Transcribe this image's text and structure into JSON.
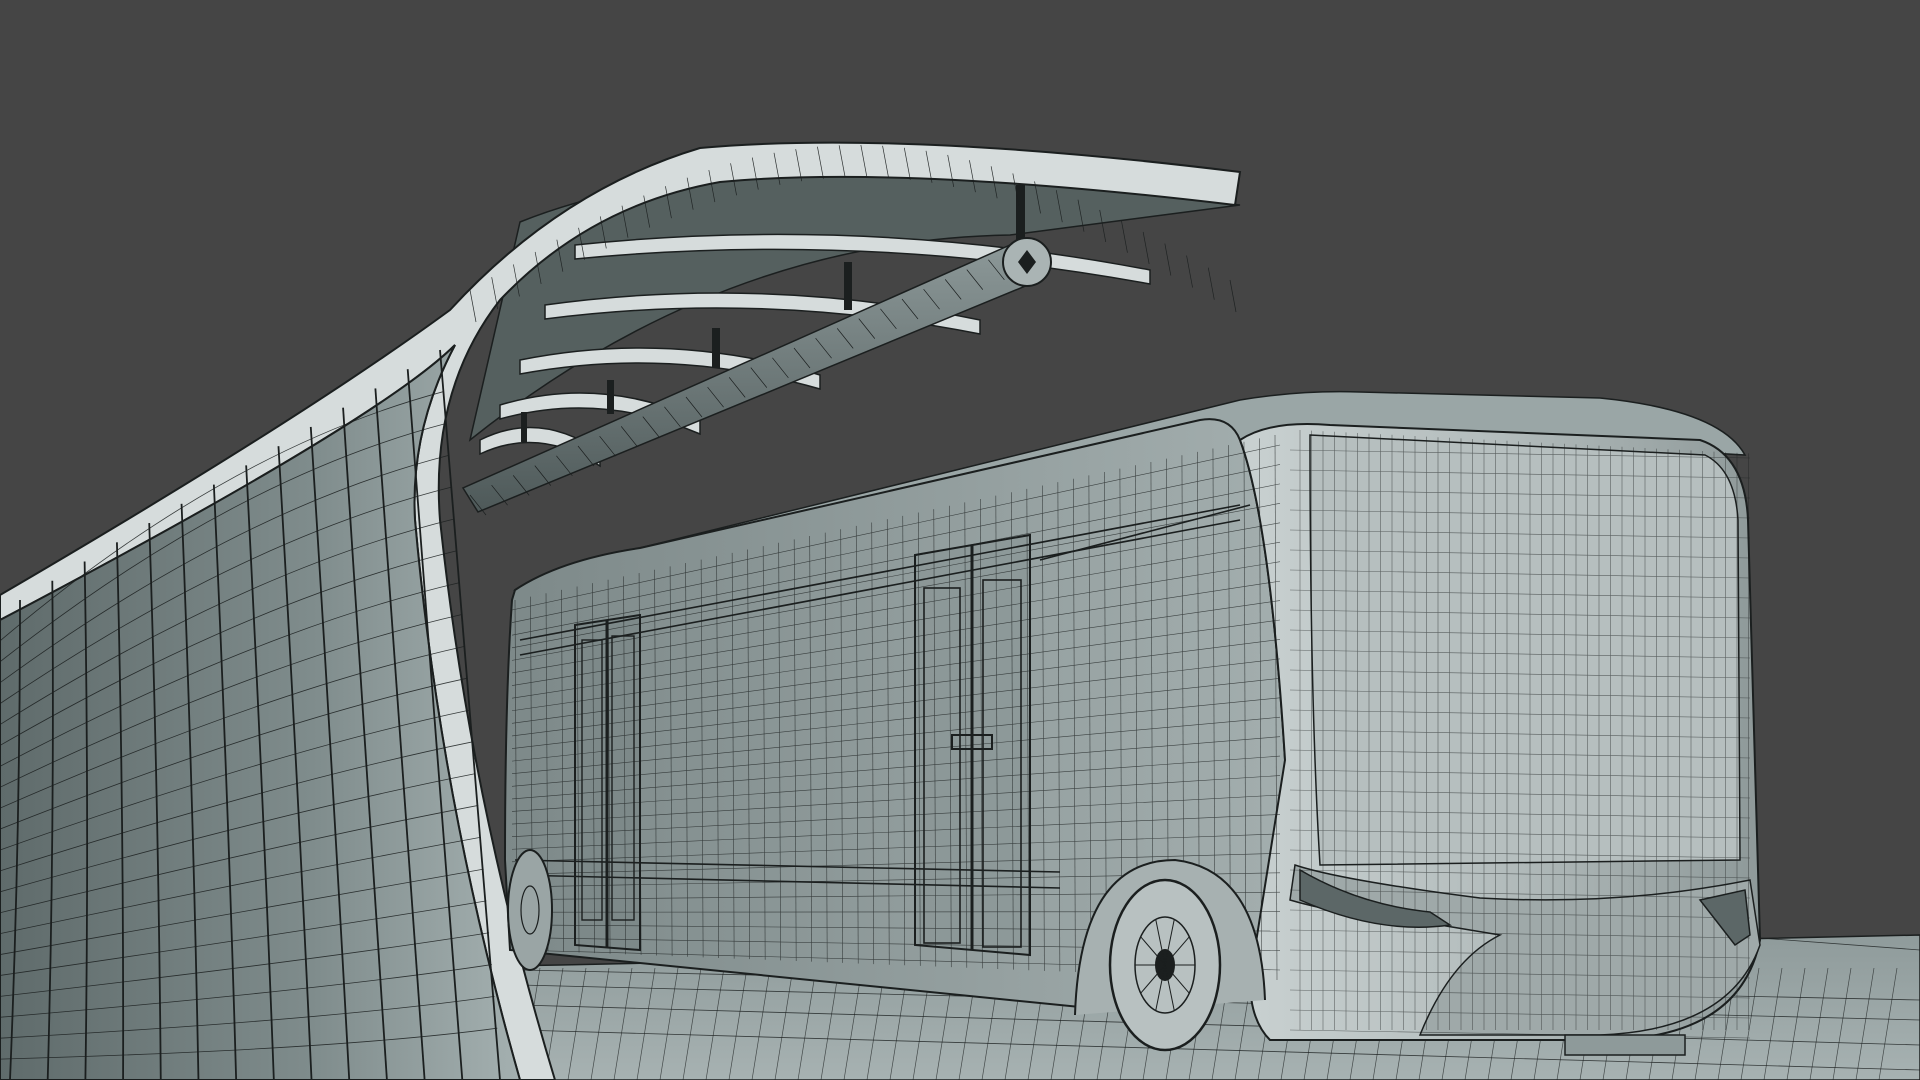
{
  "viewport": {
    "background_color": "#454545",
    "render_mode": "wireframe-on-shaded",
    "mesh_fill_color": "#9aa6a6",
    "wire_color": "#1b1f1f",
    "ground_color": "#8e9a9a",
    "objects": [
      {
        "id": "shelter-canopy",
        "label": ""
      },
      {
        "id": "bus-body",
        "label": ""
      },
      {
        "id": "ground-platform",
        "label": ""
      }
    ]
  }
}
